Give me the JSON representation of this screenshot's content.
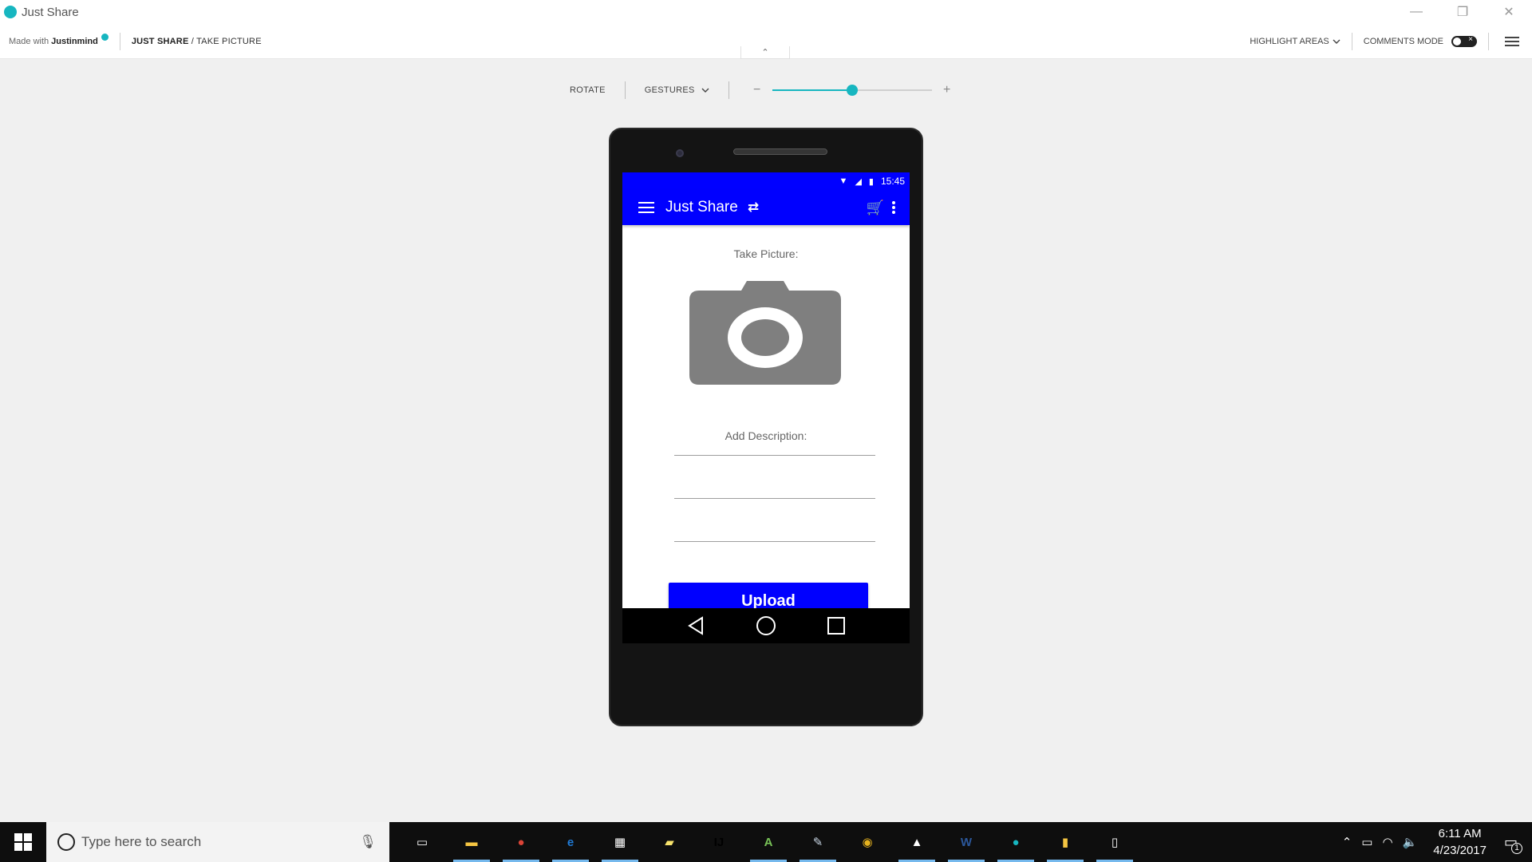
{
  "window": {
    "title": "Just Share",
    "controls": {
      "minimize": "—",
      "restore": "❐",
      "close": "✕"
    }
  },
  "header": {
    "made_with_prefix": "Made with",
    "made_with_brand": "Justinmind",
    "breadcrumb_project": "JUST SHARE",
    "breadcrumb_separator": " / ",
    "breadcrumb_page": "TAKE PICTURE",
    "highlight_areas": "HIGHLIGHT AREAS",
    "comments_mode": "COMMENTS MODE",
    "collapse_glyph": "⌃"
  },
  "sim_toolbar": {
    "rotate": "ROTATE",
    "gestures": "GESTURES",
    "zoom_minus": "−",
    "zoom_plus": "+",
    "zoom_level": 0.5
  },
  "phone": {
    "status_time": "15:45",
    "app_title": "Just Share",
    "swap_glyph": "⇄",
    "cart_glyph": "🛒",
    "take_picture_label": "Take Picture:",
    "add_description_label": "Add Description:",
    "upload_label": "Upload"
  },
  "taskbar": {
    "search_placeholder": "Type here to search",
    "time": "6:11 AM",
    "date": "4/23/2017",
    "notification_count": "1",
    "icons": [
      {
        "name": "task-view-icon",
        "glyph": "▭",
        "color": "#0e0e0e"
      },
      {
        "name": "file-explorer-icon",
        "glyph": "▬",
        "color": "#f5c542"
      },
      {
        "name": "chrome-icon",
        "glyph": "●",
        "color": "#db4437"
      },
      {
        "name": "edge-icon",
        "glyph": "e",
        "color": "#1f7ad6"
      },
      {
        "name": "store-icon",
        "glyph": "▦",
        "color": "#ffffff"
      },
      {
        "name": "sticky-notes-icon",
        "glyph": "▰",
        "color": "#f7e36c"
      },
      {
        "name": "intellij-icon",
        "glyph": "IJ",
        "color": "#000000"
      },
      {
        "name": "android-studio-icon",
        "glyph": "A",
        "color": "#78c257"
      },
      {
        "name": "paint-icon",
        "glyph": "✎",
        "color": "#c9d7e6"
      },
      {
        "name": "database-icon",
        "glyph": "◉",
        "color": "#e5b21f"
      },
      {
        "name": "photos-icon",
        "glyph": "▲",
        "color": "#ffffff"
      },
      {
        "name": "word-icon",
        "glyph": "W",
        "color": "#2b579a"
      },
      {
        "name": "justinmind-icon",
        "glyph": "●",
        "color": "#17b6c0"
      },
      {
        "name": "folder-icon",
        "glyph": "▮",
        "color": "#f5c542"
      },
      {
        "name": "document-icon",
        "glyph": "▯",
        "color": "#ffffff"
      }
    ]
  },
  "colors": {
    "accent": "#17b6c0",
    "app_bar": "#0000ff",
    "camera_gray": "#7f7f7f"
  }
}
